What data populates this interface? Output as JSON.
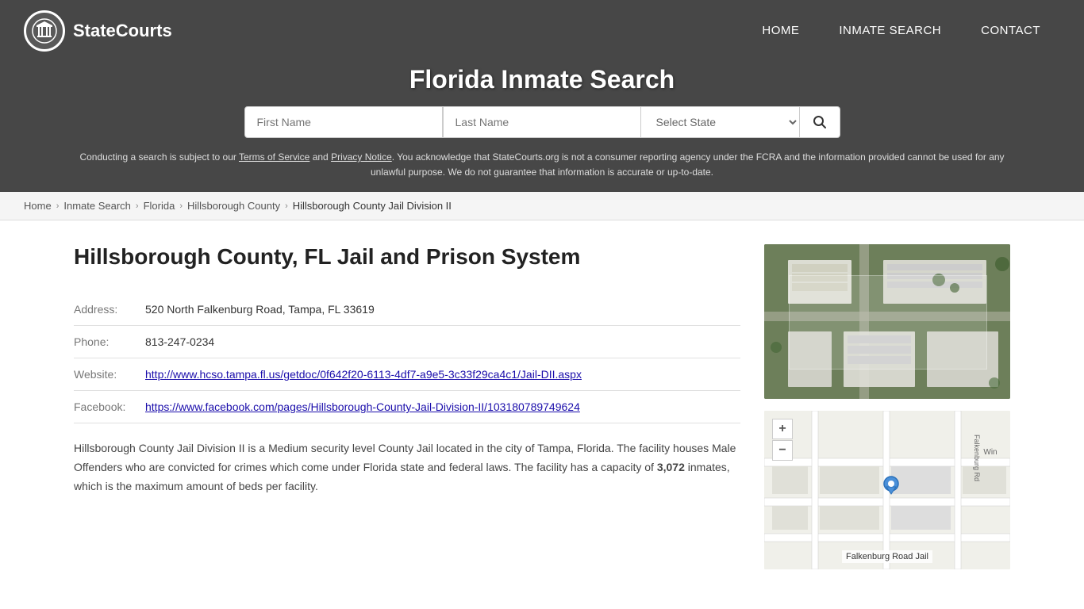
{
  "site": {
    "name": "StateCourts"
  },
  "nav": {
    "home_label": "HOME",
    "inmate_search_label": "INMATE SEARCH",
    "contact_label": "CONTACT"
  },
  "header": {
    "title": "Florida Inmate Search",
    "search": {
      "first_name_placeholder": "First Name",
      "last_name_placeholder": "Last Name",
      "state_placeholder": "Select State"
    },
    "disclaimer": "Conducting a search is subject to our Terms of Service and Privacy Notice. You acknowledge that StateCourts.org is not a consumer reporting agency under the FCRA and the information provided cannot be used for any unlawful purpose. We do not guarantee that information is accurate or up-to-date."
  },
  "breadcrumb": {
    "items": [
      {
        "label": "Home",
        "href": "#"
      },
      {
        "label": "Inmate Search",
        "href": "#"
      },
      {
        "label": "Florida",
        "href": "#"
      },
      {
        "label": "Hillsborough County",
        "href": "#"
      },
      {
        "label": "Hillsborough County Jail Division II",
        "href": null
      }
    ]
  },
  "facility": {
    "heading": "Hillsborough County, FL Jail and Prison System",
    "address_label": "Address:",
    "address_value": "520 North Falkenburg Road, Tampa, FL 33619",
    "phone_label": "Phone:",
    "phone_value": "813-247-0234",
    "website_label": "Website:",
    "website_url": "http://www.hcso.tampa.fl.us/getdoc/0f642f20-6113-4df7-a9e5-3c33f29ca4c1/Jail-DII.aspx",
    "website_text": "http://www.hcso.tampa.fl.us/getdoc/0f642f20-6113-4df7-a9e5-3c33f29ca4c1/Jail-DII.aspx",
    "facebook_label": "Facebook:",
    "facebook_url": "https://www.facebook.com/pages/Hillsborough-County-Jail-Division-II/103180789749624",
    "facebook_text": "https://www.facebook.com/pages/Hillsborough-County-Jail-Division-II/103180789749624",
    "description_part1": "Hillsborough County Jail Division II is a Medium security level County Jail located in the city of Tampa, Florida. The facility houses Male Offenders who are convicted for crimes which come under Florida state and federal laws. The facility has a capacity of ",
    "capacity": "3,072",
    "description_part2": " inmates, which is the maximum amount of beds per facility.",
    "map_label": "Falkenburg Road Jail",
    "map_road_label": "Falkenburg Rd",
    "map_road_label2": "Win"
  }
}
